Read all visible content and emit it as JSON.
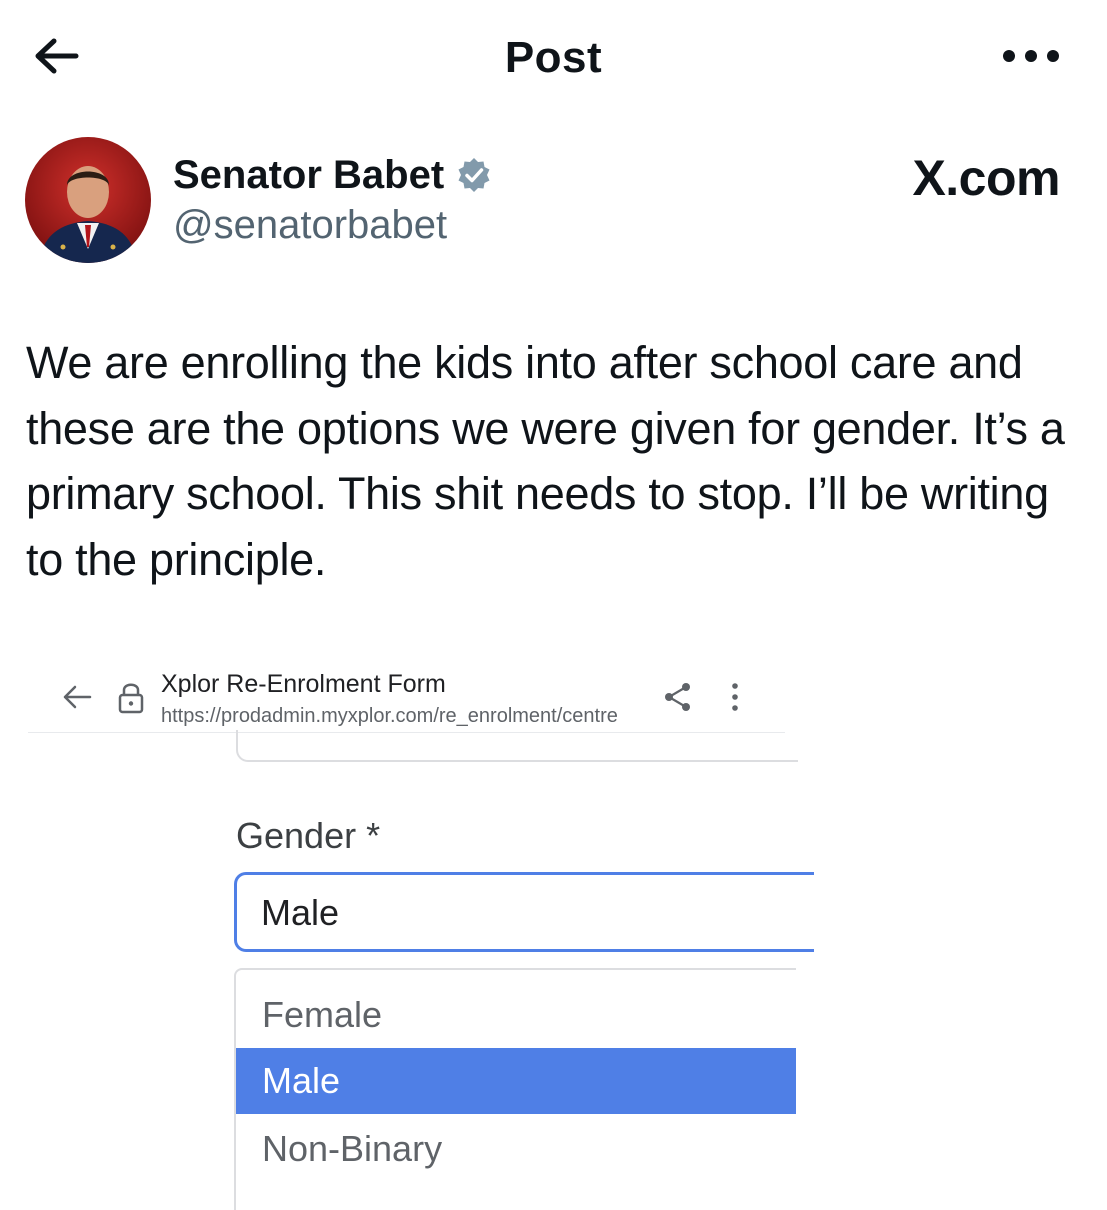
{
  "header": {
    "title": "Post"
  },
  "author": {
    "name": "Senator Babet",
    "handle": "@senatorbabet",
    "verified": true
  },
  "site_label": "X.com",
  "post": {
    "text": "We are enrolling the kids into after school care and these are the options we were given for gender. It’s a primary school. This shit needs to stop. I’ll be writing to the principle."
  },
  "embedded_screenshot": {
    "browser": {
      "title": "Xplor Re-Enrolment Form",
      "url": "https://prodadmin.myxplor.com/re_enrolment/centre"
    },
    "form": {
      "gender_label": "Gender *",
      "gender_value": "Male",
      "options": [
        "Female",
        "Male",
        "Non-Binary"
      ],
      "selected_option": "Male"
    }
  },
  "colors": {
    "accent_blue": "#4f7fe6",
    "verified_badge": "#829aab",
    "handle_gray": "#536471"
  },
  "icons": [
    "back-arrow-icon",
    "more-icon",
    "verified-icon",
    "lock-icon",
    "share-icon",
    "kebab-menu-icon"
  ]
}
